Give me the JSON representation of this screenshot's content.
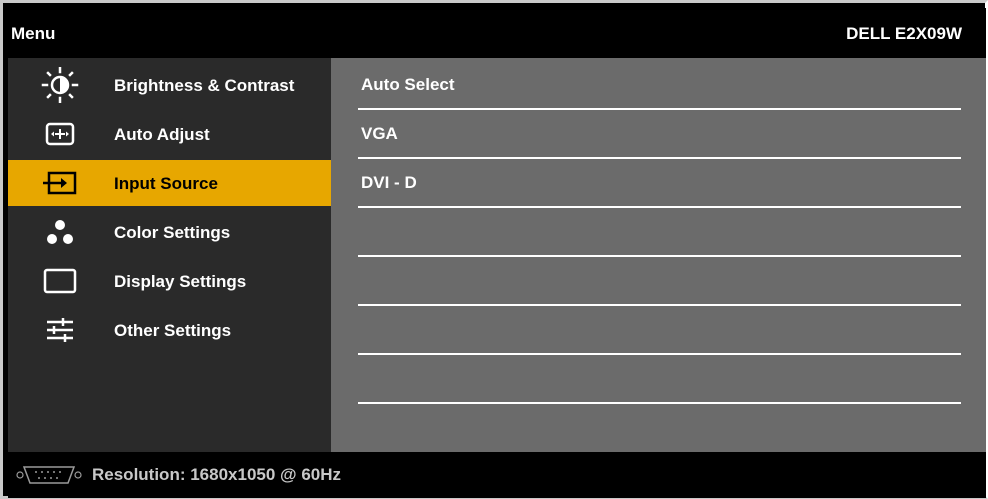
{
  "header": {
    "title": "Menu",
    "model": "DELL E2X09W"
  },
  "sidebar": {
    "items": [
      {
        "label": "Brightness & Contrast",
        "icon": "brightness-icon",
        "active": false
      },
      {
        "label": "Auto Adjust",
        "icon": "auto-adjust-icon",
        "active": false
      },
      {
        "label": "Input Source",
        "icon": "input-source-icon",
        "active": true
      },
      {
        "label": "Color Settings",
        "icon": "color-settings-icon",
        "active": false
      },
      {
        "label": "Display Settings",
        "icon": "display-settings-icon",
        "active": false
      },
      {
        "label": "Other Settings",
        "icon": "other-settings-icon",
        "active": false
      }
    ]
  },
  "content": {
    "options": [
      {
        "label": "Auto Select"
      },
      {
        "label": "VGA"
      },
      {
        "label": "DVI - D"
      },
      {
        "label": ""
      },
      {
        "label": ""
      },
      {
        "label": ""
      },
      {
        "label": ""
      }
    ]
  },
  "footer": {
    "resolution_text": "Resolution: 1680x1050 @ 60Hz",
    "icon": "vga-connector-icon"
  },
  "colors": {
    "accent": "#e7a700",
    "sidebar_bg": "#2a2a2a",
    "content_bg": "#6b6b6b",
    "header_bg": "#000000"
  }
}
